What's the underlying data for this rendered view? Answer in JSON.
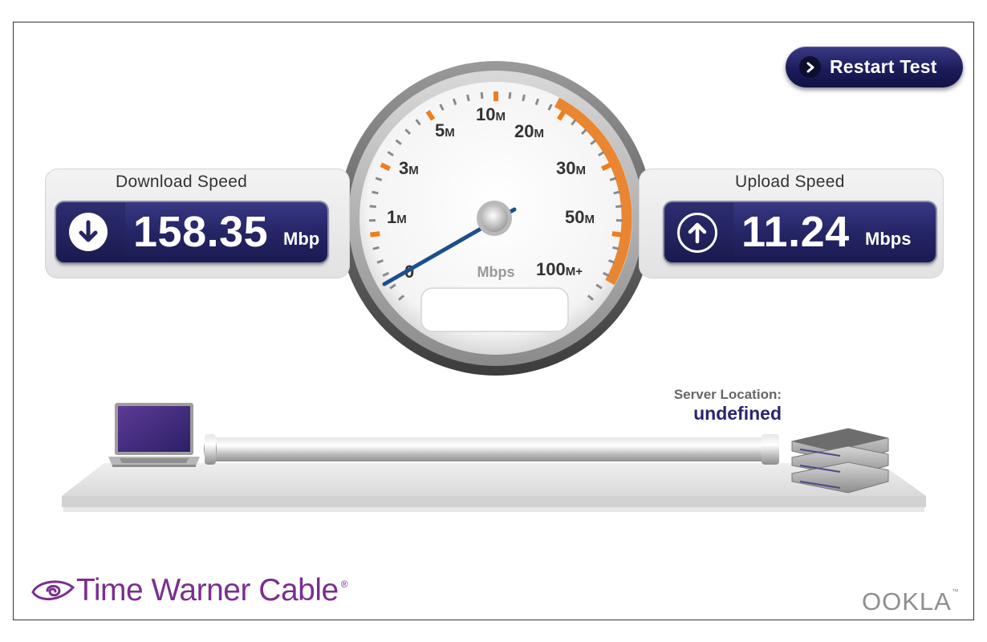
{
  "header": {
    "restart_label": "Restart Test"
  },
  "download": {
    "title": "Download Speed",
    "value": "158.35",
    "unit": "Mbp"
  },
  "upload": {
    "title": "Upload Speed",
    "value": "11.24",
    "unit": "Mbps"
  },
  "gauge": {
    "scale_labels": [
      {
        "num": "0",
        "suffix": ""
      },
      {
        "num": "1",
        "suffix": "M"
      },
      {
        "num": "3",
        "suffix": "M"
      },
      {
        "num": "5",
        "suffix": "M"
      },
      {
        "num": "10",
        "suffix": "M"
      },
      {
        "num": "20",
        "suffix": "M"
      },
      {
        "num": "30",
        "suffix": "M"
      },
      {
        "num": "50",
        "suffix": "M"
      },
      {
        "num": "100",
        "suffix": "M+"
      }
    ],
    "unit_label": "Mbps",
    "display_text": ""
  },
  "server": {
    "label": "Server Location:",
    "value": "undefined"
  },
  "brand": {
    "name": "Time Warner Cable",
    "registered": "®"
  },
  "footer": {
    "logo": "OOKLA",
    "tm": "™"
  },
  "colors": {
    "accent_orange": "#f07d1d",
    "panel_navy": "#252566",
    "brand_purple": "#7a2f8f",
    "server_value": "#262670"
  },
  "icons": {
    "restart": "chevron-right-icon",
    "download": "arrow-down-icon",
    "upload": "arrow-up-icon",
    "client": "laptop-icon",
    "server": "server-stack-icon",
    "brand": "tw-eye-logo-icon"
  }
}
